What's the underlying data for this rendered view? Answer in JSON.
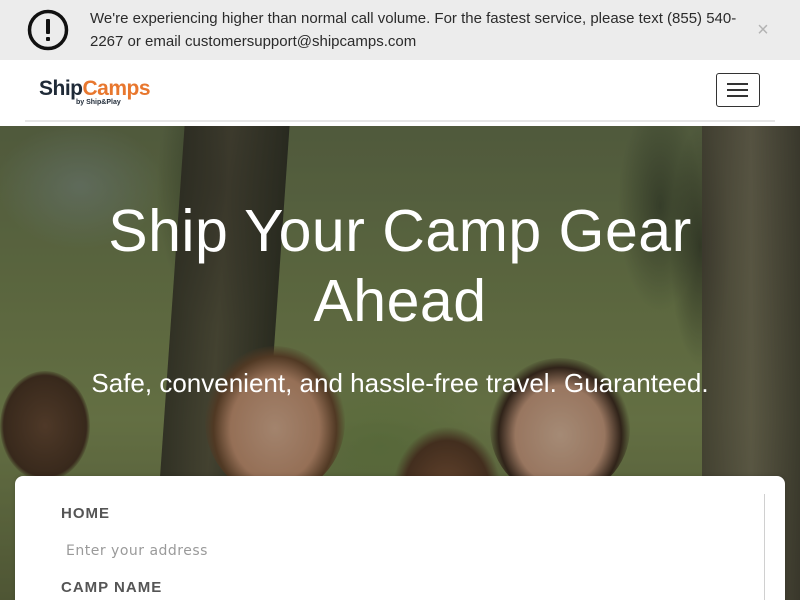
{
  "alert": {
    "icon": "exclamation-circle-icon",
    "message": "We're experiencing higher than normal call volume. For the fastest service, please text (855) 540-2267 or email customersupport@shipcamps.com",
    "close_glyph": "×"
  },
  "navbar": {
    "logo_ship": "Ship",
    "logo_camps": "Camps",
    "logo_sub": "by Ship&Play",
    "menu_icon": "hamburger-menu-icon"
  },
  "hero": {
    "title": "Ship Your Camp Gear Ahead",
    "subtitle": "Safe, convenient, and hassle-free travel. Guaranteed."
  },
  "form": {
    "home_label": "HOME",
    "home_placeholder": "Enter your address",
    "home_value": "",
    "camp_label": "CAMP NAME"
  },
  "colors": {
    "brand_dark": "#1f2a37",
    "brand_orange": "#e8772e",
    "alert_bg": "#ececec"
  }
}
